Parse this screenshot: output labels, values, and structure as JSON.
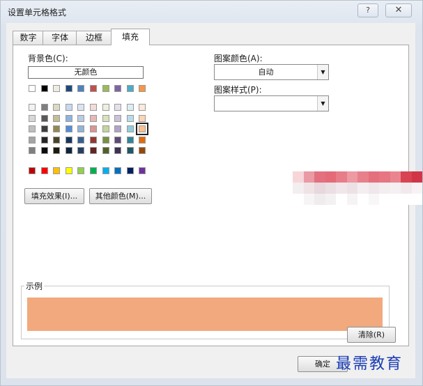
{
  "window": {
    "title": "设置单元格格式",
    "help_glyph": "?",
    "close_glyph": "✕"
  },
  "tabs": [
    {
      "label": "数字",
      "active": false
    },
    {
      "label": "字体",
      "active": false
    },
    {
      "label": "边框",
      "active": false
    },
    {
      "label": "填充",
      "active": true
    }
  ],
  "fill": {
    "background_label": "背景色(C):",
    "no_color_label": "无颜色",
    "pattern_color_label": "图案颜色(A):",
    "pattern_color_value": "自动",
    "pattern_style_label": "图案样式(P):",
    "pattern_style_value": "",
    "fill_effects_button": "填充效果(I)...",
    "more_colors_button": "其他颜色(M)...",
    "selected_color": "#f4a67d",
    "theme_top_row": [
      "#ffffff",
      "#000000",
      "#eeece1",
      "#1f497d",
      "#4f81bd",
      "#c0504d",
      "#9bbb59",
      "#8064a2",
      "#4bacc6",
      "#f79646"
    ],
    "theme_tints": [
      [
        "#f2f2f2",
        "#7f7f7f",
        "#ddd9c3",
        "#c6d9f0",
        "#dbe5f1",
        "#f2dcdb",
        "#ebf1dd",
        "#e5e0ec",
        "#dbeef3",
        "#fdeada"
      ],
      [
        "#d8d8d8",
        "#595959",
        "#c4bd97",
        "#8db3e2",
        "#b8cce4",
        "#e5b9b7",
        "#d7e3bc",
        "#ccc1d9",
        "#b7dde8",
        "#fbd5b5"
      ],
      [
        "#bfbfbf",
        "#3f3f3f",
        "#938953",
        "#548dd4",
        "#95b3d7",
        "#d99694",
        "#c3d69b",
        "#b2a2c7",
        "#92cddc",
        "#fac08f"
      ],
      [
        "#a5a5a5",
        "#262626",
        "#494429",
        "#17365d",
        "#366092",
        "#953734",
        "#76923c",
        "#5f497a",
        "#31859b",
        "#e36c09"
      ],
      [
        "#7f7f7f",
        "#0c0c0c",
        "#1d1b10",
        "#0f243e",
        "#244061",
        "#632423",
        "#4f6128",
        "#3f3151",
        "#205867",
        "#974806"
      ]
    ],
    "standard_colors": [
      "#c00000",
      "#ff0000",
      "#ffc000",
      "#ffff00",
      "#92d050",
      "#00b050",
      "#00b0f0",
      "#0070c0",
      "#002060",
      "#7030a0"
    ],
    "selected_swatch": {
      "row": 2,
      "col": 9
    }
  },
  "sample": {
    "label": "示例",
    "color": "#f2a97e"
  },
  "buttons": {
    "clear": "清除(R)",
    "ok": "确定"
  },
  "watermark": "最需教育"
}
